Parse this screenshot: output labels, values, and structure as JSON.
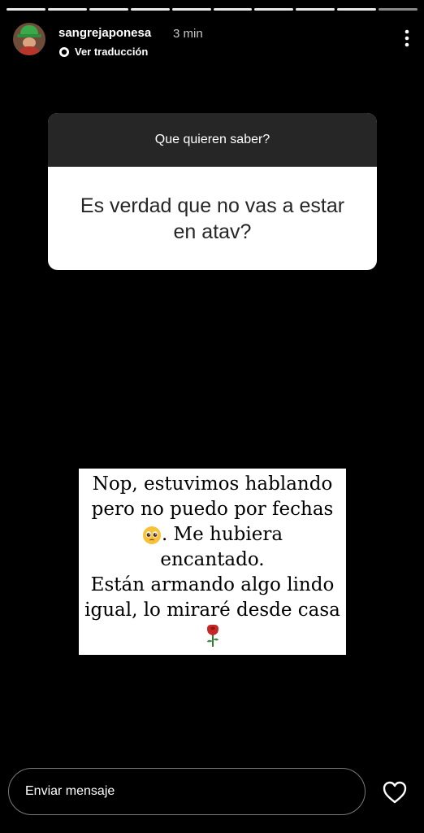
{
  "story": {
    "progress_segments": 10,
    "current_segment": 10,
    "user": {
      "username": "sangrejaponesa",
      "time": "3 min",
      "translate_label": "Ver traducción",
      "avatar_icon": "avatar-photo"
    },
    "more_icon": "more-vertical-icon"
  },
  "question": {
    "prompt": "Que quieren saber?",
    "text": "Es verdad que no vas a estar en atav?"
  },
  "answer": {
    "line1": "Nop, estuvimos hablando",
    "line2": "pero no puedo por fechas",
    "line3_emoji": "pleading-face-emoji",
    "line3": ". Me hubiera",
    "line4": "encantado.",
    "line5": "Están armando algo lindo",
    "line6": "igual, lo miraré desde casa",
    "end_emoji": "rose-emoji"
  },
  "footer": {
    "message_placeholder": "Enviar mensaje",
    "like_icon": "heart-icon"
  },
  "colors": {
    "background": "#000000",
    "question_header": "#262626",
    "card": "#ffffff"
  }
}
